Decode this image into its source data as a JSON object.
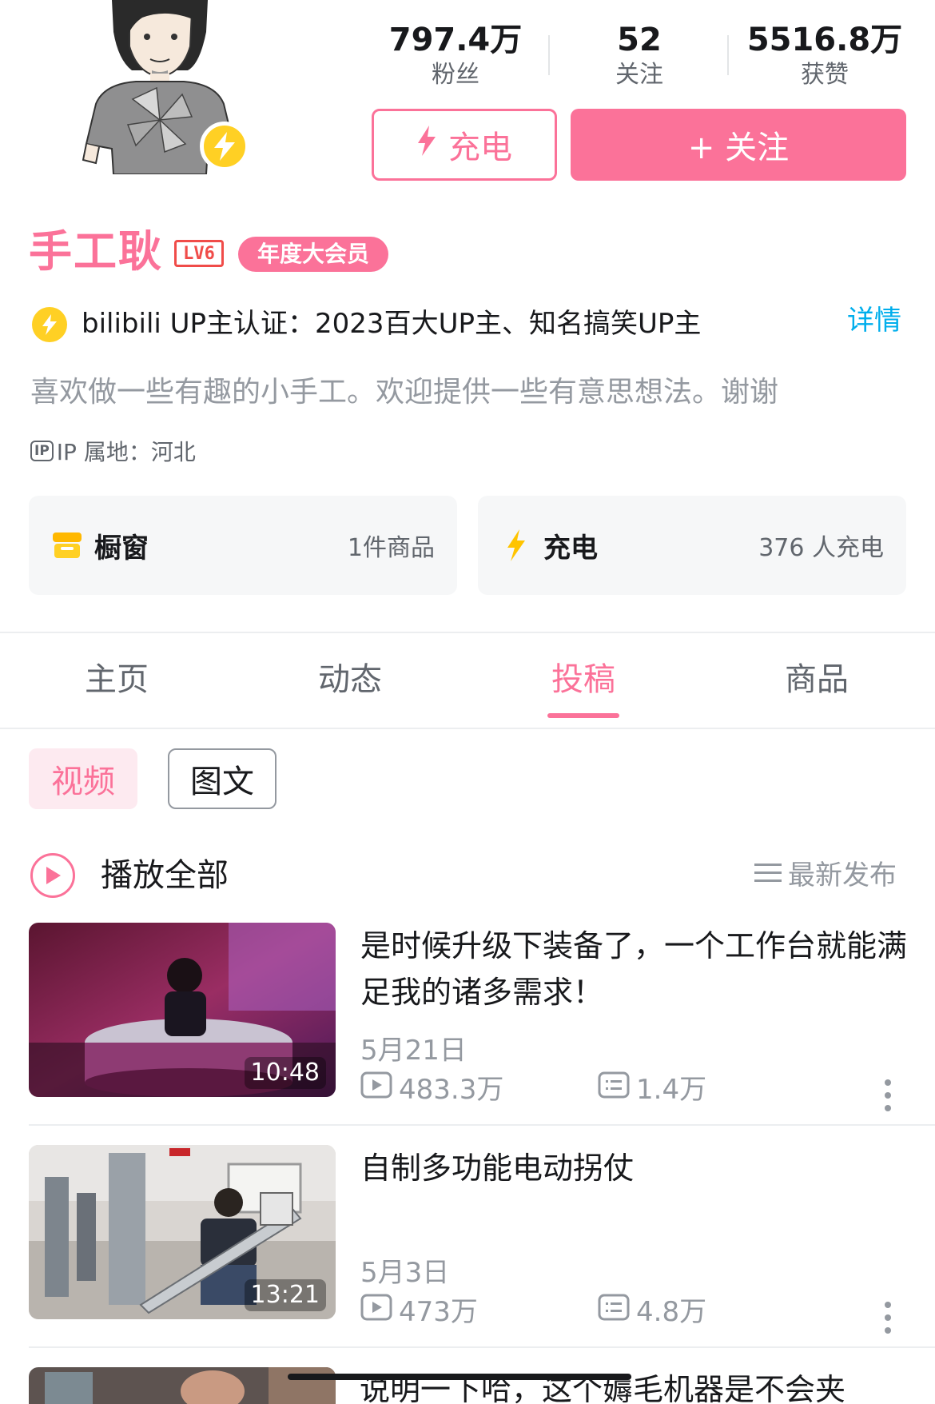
{
  "profile": {
    "stats": [
      {
        "value": "797.4万",
        "label": "粉丝"
      },
      {
        "value": "52",
        "label": "关注"
      },
      {
        "value": "5516.8万",
        "label": "获赞"
      }
    ],
    "charge_button": "充电",
    "follow_button": "+ 关注",
    "name": "手工耿",
    "level": "LV6",
    "vip_badge": "年度大会员",
    "verification": "bilibili UP主认证：2023百大UP主、知名搞笑UP主",
    "detail_link": "详情",
    "bio": "喜欢做一些有趣的小手工。欢迎提供一些有意思想法。谢谢",
    "ip_tag": "IP",
    "ip_location": "IP 属地：河北"
  },
  "cards": [
    {
      "icon": "shop-window-icon",
      "title": "橱窗",
      "value": "1件商品"
    },
    {
      "icon": "lightning-icon",
      "title": "充电",
      "value": "376 人充电"
    }
  ],
  "tabs": [
    {
      "label": "主页",
      "active": false
    },
    {
      "label": "动态",
      "active": false
    },
    {
      "label": "投稿",
      "active": true
    },
    {
      "label": "商品",
      "active": false
    }
  ],
  "filters": {
    "video": "视频",
    "article": "图文"
  },
  "playlist": {
    "play_all": "播放全部",
    "sort": "最新发布"
  },
  "videos": [
    {
      "title": "是时候升级下装备了，一个工作台就能满足我的诸多需求！",
      "duration": "10:48",
      "date": "5月21日",
      "plays": "483.3万",
      "comments": "1.4万"
    },
    {
      "title": "自制多功能电动拐仗",
      "duration": "13:21",
      "date": "5月3日",
      "plays": "473万",
      "comments": "4.8万"
    },
    {
      "title": "说明一下哈，这个薅毛机器是不会夹"
    }
  ],
  "colors": {
    "brand_pink": "#fb7299",
    "link_blue": "#00aeec",
    "charge_yellow": "#ffd024",
    "level_red": "#f04c49"
  }
}
